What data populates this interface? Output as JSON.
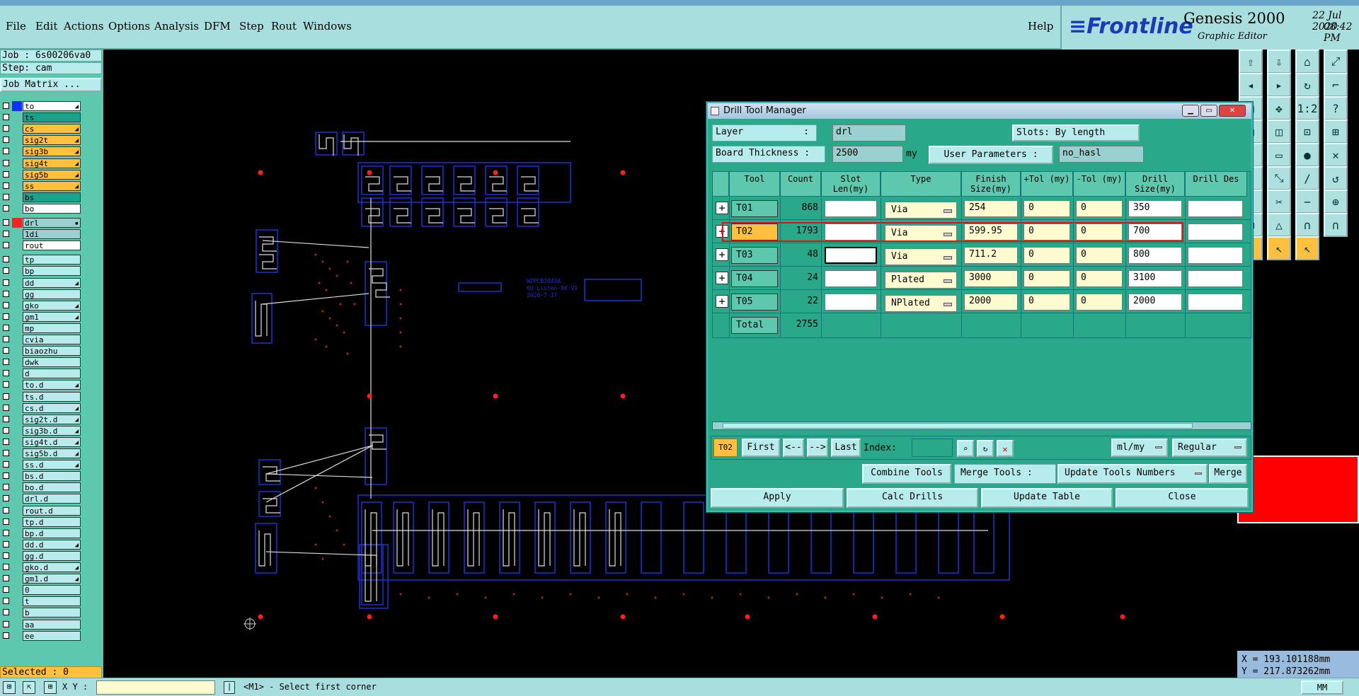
{
  "menu": [
    "File",
    "Edit",
    "Actions",
    "Options",
    "Analysis",
    "DFM",
    "Step",
    "Rout",
    "Windows"
  ],
  "help": "Help",
  "brand": {
    "logo": "Frontline",
    "product": "Genesis 2000",
    "subtitle": "Graphic Editor",
    "date": "22 Jul 2020",
    "time": "08:42 PM"
  },
  "left": {
    "job": "Job : 6s00206va0",
    "step": "Step: cam",
    "job_matrix": "Job Matrix ...",
    "selected": "Selected : 0"
  },
  "layers": [
    {
      "name": "to",
      "color": "#ffffff",
      "swatch": "#1030ff",
      "mark": "◢"
    },
    {
      "name": "ts",
      "color": "#1aa28a",
      "swatch": "",
      "mark": ""
    },
    {
      "name": "cs",
      "color": "#ffc040",
      "swatch": "",
      "mark": "◢"
    },
    {
      "name": "sig2t",
      "color": "#ffc040",
      "swatch": "",
      "mark": "◢"
    },
    {
      "name": "sig3b",
      "color": "#ffc040",
      "swatch": "",
      "mark": "◢"
    },
    {
      "name": "sig4t",
      "color": "#ffc040",
      "swatch": "",
      "mark": "◢"
    },
    {
      "name": "sig5b",
      "color": "#ffc040",
      "swatch": "",
      "mark": "◢"
    },
    {
      "name": "ss",
      "color": "#ffc040",
      "swatch": "",
      "mark": "◢"
    },
    {
      "name": "bs",
      "color": "#1aa28a",
      "swatch": "",
      "mark": ""
    },
    {
      "name": "bo",
      "color": "#ffffff",
      "swatch": "",
      "mark": ""
    },
    {
      "name": "drl",
      "color": "#9ad0d0",
      "swatch": "#ff2020",
      "mark": "▪",
      "gap": true
    },
    {
      "name": "1di",
      "color": "#9ad0d0",
      "swatch": "",
      "mark": ""
    },
    {
      "name": "rout",
      "color": "#ffffff",
      "swatch": "",
      "mark": ""
    },
    {
      "name": "tp",
      "color": "#b8ecec",
      "swatch": "",
      "mark": "",
      "gap": true
    },
    {
      "name": "bp",
      "color": "#b8ecec",
      "swatch": "",
      "mark": ""
    },
    {
      "name": "dd",
      "color": "#b8ecec",
      "swatch": "",
      "mark": "◢"
    },
    {
      "name": "gg",
      "color": "#b8ecec",
      "swatch": "",
      "mark": ""
    },
    {
      "name": "gko",
      "color": "#b8ecec",
      "swatch": "",
      "mark": "◢"
    },
    {
      "name": "gm1",
      "color": "#b8ecec",
      "swatch": "",
      "mark": "◢"
    },
    {
      "name": "mp",
      "color": "#b8ecec",
      "swatch": "",
      "mark": ""
    },
    {
      "name": "cvia",
      "color": "#b8ecec",
      "swatch": "",
      "mark": ""
    },
    {
      "name": "biaozhu",
      "color": "#b8ecec",
      "swatch": "",
      "mark": ""
    },
    {
      "name": "dwk",
      "color": "#b8ecec",
      "swatch": "",
      "mark": ""
    },
    {
      "name": "d",
      "color": "#b8ecec",
      "swatch": "",
      "mark": ""
    },
    {
      "name": "to.d",
      "color": "#b8ecec",
      "swatch": "",
      "mark": "◢"
    },
    {
      "name": "ts.d",
      "color": "#b8ecec",
      "swatch": "",
      "mark": ""
    },
    {
      "name": "cs.d",
      "color": "#b8ecec",
      "swatch": "",
      "mark": "◢"
    },
    {
      "name": "sig2t.d",
      "color": "#b8ecec",
      "swatch": "",
      "mark": "◢"
    },
    {
      "name": "sig3b.d",
      "color": "#b8ecec",
      "swatch": "",
      "mark": "◢"
    },
    {
      "name": "sig4t.d",
      "color": "#b8ecec",
      "swatch": "",
      "mark": "◢"
    },
    {
      "name": "sig5b.d",
      "color": "#b8ecec",
      "swatch": "",
      "mark": "◢"
    },
    {
      "name": "ss.d",
      "color": "#b8ecec",
      "swatch": "",
      "mark": "◢"
    },
    {
      "name": "bs.d",
      "color": "#b8ecec",
      "swatch": "",
      "mark": ""
    },
    {
      "name": "bo.d",
      "color": "#b8ecec",
      "swatch": "",
      "mark": ""
    },
    {
      "name": "drl.d",
      "color": "#b8ecec",
      "swatch": "",
      "mark": ""
    },
    {
      "name": "rout.d",
      "color": "#b8ecec",
      "swatch": "",
      "mark": ""
    },
    {
      "name": "tp.d",
      "color": "#b8ecec",
      "swatch": "",
      "mark": ""
    },
    {
      "name": "bp.d",
      "color": "#b8ecec",
      "swatch": "",
      "mark": ""
    },
    {
      "name": "dd.d",
      "color": "#b8ecec",
      "swatch": "",
      "mark": "◢"
    },
    {
      "name": "gg.d",
      "color": "#b8ecec",
      "swatch": "",
      "mark": ""
    },
    {
      "name": "gko.d",
      "color": "#b8ecec",
      "swatch": "",
      "mark": "◢"
    },
    {
      "name": "gm1.d",
      "color": "#b8ecec",
      "swatch": "",
      "mark": "◢"
    },
    {
      "name": "0",
      "color": "#b8ecec",
      "swatch": "",
      "mark": ""
    },
    {
      "name": "t",
      "color": "#b8ecec",
      "swatch": "",
      "mark": ""
    },
    {
      "name": "b",
      "color": "#b8ecec",
      "swatch": "",
      "mark": ""
    },
    {
      "name": "aa",
      "color": "#b8ecec",
      "swatch": "",
      "mark": ""
    },
    {
      "name": "ee",
      "color": "#b8ecec",
      "swatch": "",
      "mark": ""
    }
  ],
  "canvas_text": {
    "t1": "WZPCB2043A",
    "t2": "6U-Listen-8K-V1",
    "t3": "2020-7-17"
  },
  "dialog": {
    "title": "Drill Tool Manager",
    "layer_label": "Layer",
    "layer_value": "drl",
    "slots_label": "Slots:",
    "slots_value": "By length",
    "thickness_label": "Board Thickness :",
    "thickness_value": "2500",
    "thickness_unit": "my",
    "user_params_label": "User Parameters :",
    "user_params_value": "no_hasl",
    "columns": [
      "Tool",
      "Count",
      "Slot Len(my)",
      "Type",
      "Finish Size(my)",
      "+Tol (my)",
      "-Tol (my)",
      "Drill Size(my)",
      "Drill Des"
    ],
    "rows": [
      {
        "tool": "T01",
        "count": "868",
        "slot": "",
        "type": "Via",
        "finish": "254",
        "ptol": "0",
        "mtol": "0",
        "drill": "350",
        "des": ""
      },
      {
        "tool": "T02",
        "count": "1793",
        "slot": "",
        "type": "Via",
        "finish": "599.95",
        "ptol": "0",
        "mtol": "0",
        "drill": "700",
        "des": ""
      },
      {
        "tool": "T03",
        "count": "48",
        "slot": "",
        "type": "Via",
        "finish": "711.2",
        "ptol": "0",
        "mtol": "0",
        "drill": "800",
        "des": ""
      },
      {
        "tool": "T04",
        "count": "24",
        "slot": "",
        "type": "Plated",
        "finish": "3000",
        "ptol": "0",
        "mtol": "0",
        "drill": "3100",
        "des": ""
      },
      {
        "tool": "T05",
        "count": "22",
        "slot": "",
        "type": "NPlated",
        "finish": "2000",
        "ptol": "0",
        "mtol": "0",
        "drill": "2000",
        "des": ""
      }
    ],
    "total_label": "Total",
    "total_value": "2755",
    "current_tool": "T02",
    "nav": {
      "first": "First",
      "prev": "<--",
      "next": "-->",
      "last": "Last",
      "index": "Index:"
    },
    "units": "ml/my",
    "mode": "Regular",
    "combine": "Combine Tools",
    "merge_label": "Merge Tools :",
    "merge_value": "Update Tools Numbers",
    "merge_btn": "Merge",
    "apply": "Apply",
    "calc": "Calc Drills",
    "update": "Update Table",
    "close": "Close"
  },
  "coords": {
    "x": "X = 193.101188mm",
    "y": "Y = 217.873262mm"
  },
  "status": {
    "xy": "X Y :",
    "prompt": "<M1> - Select first corner",
    "unit": "MM"
  }
}
